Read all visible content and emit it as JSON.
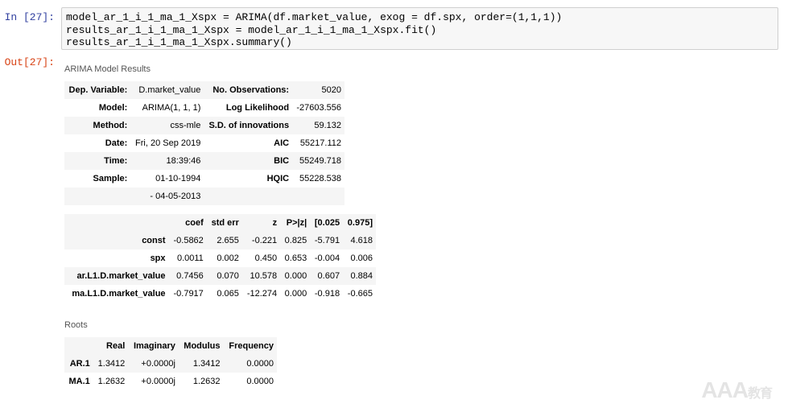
{
  "input_prompt": "In [27]:",
  "output_prompt": "Out[27]:",
  "code_lines": [
    "model_ar_1_i_1_ma_1_Xspx = ARIMA(df.market_value, exog = df.spx, order=(1,1,1))",
    "results_ar_1_i_1_ma_1_Xspx = model_ar_1_i_1_ma_1_Xspx.fit()",
    "results_ar_1_i_1_ma_1_Xspx.summary()"
  ],
  "model_caption": "ARIMA Model Results",
  "model_info": [
    [
      "Dep. Variable:",
      "D.market_value",
      "No. Observations:",
      "5020"
    ],
    [
      "Model:",
      "ARIMA(1, 1, 1)",
      "Log Likelihood",
      "-27603.556"
    ],
    [
      "Method:",
      "css-mle",
      "S.D. of innovations",
      "59.132"
    ],
    [
      "Date:",
      "Fri, 20 Sep 2019",
      "AIC",
      "55217.112"
    ],
    [
      "Time:",
      "18:39:46",
      "BIC",
      "55249.718"
    ],
    [
      "Sample:",
      "01-10-1994",
      "HQIC",
      "55228.538"
    ],
    [
      "",
      "- 04-05-2013",
      "",
      ""
    ]
  ],
  "coef_headers": [
    "",
    "coef",
    "std err",
    "z",
    "P>|z|",
    "[0.025",
    "0.975]"
  ],
  "coef_rows": [
    [
      "const",
      "-0.5862",
      "2.655",
      "-0.221",
      "0.825",
      "-5.791",
      "4.618"
    ],
    [
      "spx",
      "0.0011",
      "0.002",
      "0.450",
      "0.653",
      "-0.004",
      "0.006"
    ],
    [
      "ar.L1.D.market_value",
      "0.7456",
      "0.070",
      "10.578",
      "0.000",
      "0.607",
      "0.884"
    ],
    [
      "ma.L1.D.market_value",
      "-0.7917",
      "0.065",
      "-12.274",
      "0.000",
      "-0.918",
      "-0.665"
    ]
  ],
  "roots_caption": "Roots",
  "roots_headers": [
    "",
    "Real",
    "Imaginary",
    "Modulus",
    "Frequency"
  ],
  "roots_rows": [
    [
      "AR.1",
      "1.3412",
      "+0.0000j",
      "1.3412",
      "0.0000"
    ],
    [
      "MA.1",
      "1.2632",
      "+0.0000j",
      "1.2632",
      "0.0000"
    ]
  ],
  "watermark": {
    "latin": "AAA",
    "cjk": "教育"
  }
}
